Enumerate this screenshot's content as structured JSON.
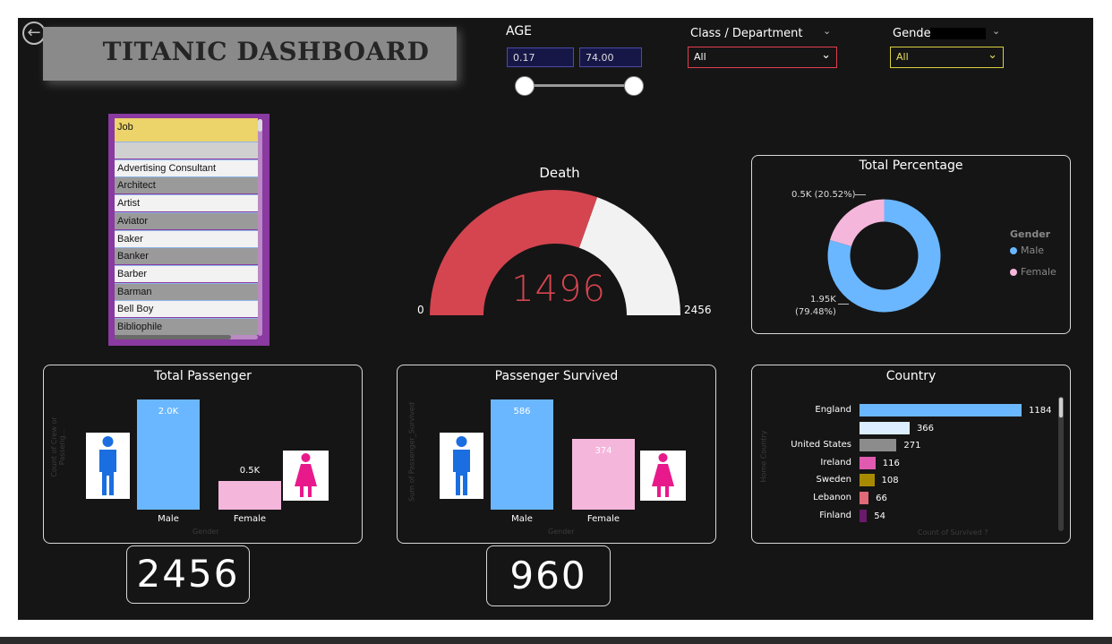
{
  "header": {
    "title": "TITANIC DASHBOARD",
    "back_icon": "back-arrow-icon"
  },
  "age_filter": {
    "label": "AGE",
    "min_value": "0.17",
    "max_value": "74.00",
    "slider_min": 0.17,
    "slider_max": 74.0
  },
  "class_filter": {
    "label": "Class / Department",
    "value": "All",
    "box_color": "#6a1a24"
  },
  "gender_filter": {
    "label": "Gender",
    "value": "All",
    "box_color": "#1c1c0a"
  },
  "job_list": {
    "header": "Job",
    "items": [
      "",
      "Advertising Consultant",
      "Architect",
      "Artist",
      "Aviator",
      "Baker",
      "Banker",
      "Barber",
      "Barman",
      "Bell Boy",
      "Bibliophile"
    ]
  },
  "death_gauge": {
    "title": "Death",
    "value": 1496,
    "value_label": "1496",
    "min_label": "0",
    "max_label": "2456",
    "min": 0,
    "max": 2456,
    "fill_color": "#d4454f",
    "track_color": "#f2f2f2"
  },
  "total_percentage": {
    "title": "Total Percentage",
    "legend_title": "Gender",
    "slices": [
      {
        "name": "Male",
        "value": 1.95,
        "percent": 79.48,
        "label_line1": "1.95K",
        "label_line2": "(79.48%)",
        "color": "#6ab7ff"
      },
      {
        "name": "Female",
        "value": 0.5,
        "percent": 20.52,
        "label_line1": "0.5K (20.52%)",
        "color": "#f5b6dc"
      }
    ]
  },
  "total_passenger": {
    "title": "Total Passenger",
    "y_axis": "Count of Crew or Passeng...",
    "x_axis": "Gender",
    "categories": [
      "Male",
      "Female"
    ],
    "values": [
      1950,
      506
    ],
    "value_labels": [
      "2.0K",
      "0.5K"
    ],
    "colors": [
      "#6ab7ff",
      "#f5b6dc"
    ],
    "total_label": "2456"
  },
  "passenger_survived": {
    "title": "Passenger Survived",
    "y_axis": "Sum of Passenger_Survived",
    "x_axis": "Gender",
    "categories": [
      "Male",
      "Female"
    ],
    "values": [
      586,
      374
    ],
    "value_labels": [
      "586",
      "374"
    ],
    "colors": [
      "#6ab7ff",
      "#f5b6dc"
    ],
    "total_label": "960"
  },
  "country": {
    "title": "Country",
    "y_axis": "Home Country",
    "x_axis": "Count of Survived ?",
    "rows": [
      {
        "name": "England",
        "value": 1184,
        "label": "1184",
        "color": "#6ab7ff"
      },
      {
        "name": "",
        "value": 366,
        "label": "366",
        "color": "#dceeff"
      },
      {
        "name": "United States",
        "value": 271,
        "label": "271",
        "color": "#8c8c8c"
      },
      {
        "name": "Ireland",
        "value": 116,
        "label": "116",
        "color": "#e05ab0"
      },
      {
        "name": "Sweden",
        "value": 108,
        "label": "108",
        "color": "#a88a00"
      },
      {
        "name": "Lebanon",
        "value": 66,
        "label": "66",
        "color": "#e06a78"
      },
      {
        "name": "Finland",
        "value": 54,
        "label": "54",
        "color": "#6a1a6a"
      }
    ]
  },
  "icons": {
    "male": "male-person-icon",
    "female": "female-person-icon",
    "dropdown": "chevron-down-icon"
  }
}
